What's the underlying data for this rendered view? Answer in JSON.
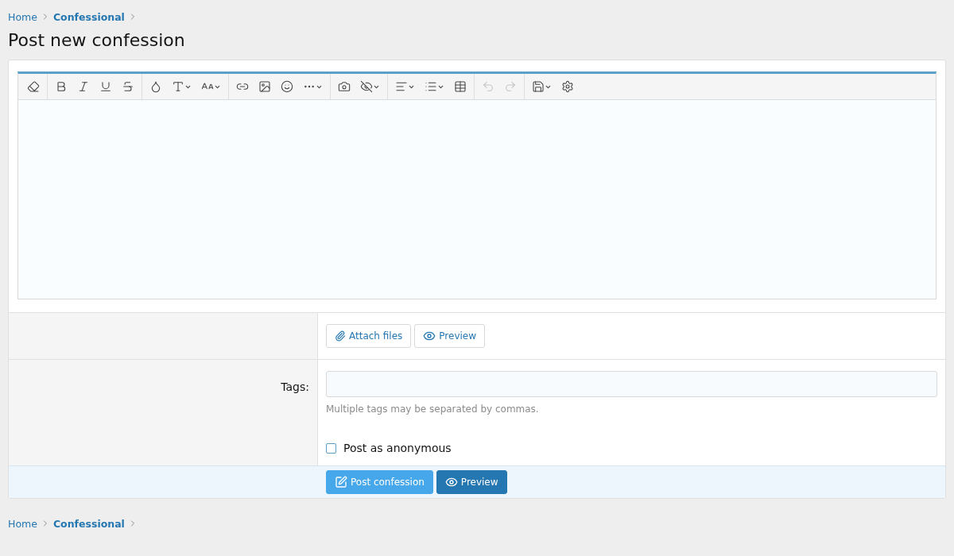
{
  "breadcrumb_top": [
    {
      "label": "Home",
      "current": false
    },
    {
      "label": "Confessional",
      "current": true
    }
  ],
  "title": "Post new confession",
  "editor": {
    "toolbar_groups": [
      [
        {
          "menu": false,
          "disabled": false
        }
      ],
      [
        {
          "menu": false,
          "disabled": false
        },
        {
          "menu": false,
          "disabled": false
        },
        {
          "menu": false,
          "disabled": false
        },
        {
          "menu": false,
          "disabled": false
        }
      ],
      [
        {
          "menu": false,
          "disabled": false
        },
        {
          "menu": true,
          "disabled": false
        },
        {
          "menu": true,
          "disabled": false
        }
      ],
      [
        {
          "menu": false,
          "disabled": false
        },
        {
          "menu": false,
          "disabled": false
        },
        {
          "menu": false,
          "disabled": false
        },
        {
          "menu": true,
          "disabled": false
        }
      ],
      [
        {
          "menu": false,
          "disabled": false
        },
        {
          "menu": true,
          "disabled": false
        }
      ],
      [
        {
          "menu": true,
          "disabled": false
        },
        {
          "menu": true,
          "disabled": false
        },
        {
          "menu": false,
          "disabled": false
        }
      ],
      [
        {
          "menu": false,
          "disabled": true
        },
        {
          "menu": false,
          "disabled": true
        }
      ],
      [
        {
          "menu": true,
          "disabled": false
        },
        {
          "menu": false,
          "disabled": false
        }
      ]
    ]
  },
  "attach_button": "Attach files",
  "preview_button": "Preview",
  "tags": {
    "label": "Tags:",
    "hint": "Multiple tags may be separated by commas."
  },
  "anonymous": {
    "label": "Post as anonymous",
    "checked": false
  },
  "submit_button": "Post confession",
  "footer_preview_button": "Preview",
  "breadcrumb_bottom": [
    {
      "label": "Home",
      "current": false
    },
    {
      "label": "Confessional",
      "current": true
    }
  ]
}
